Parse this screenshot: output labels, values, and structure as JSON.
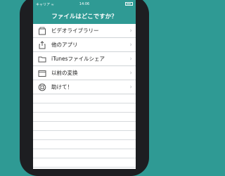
{
  "status": {
    "carrier": "キャリア ≈",
    "time": "14:06"
  },
  "nav": {
    "title": "ファイルはどこですか？"
  },
  "items": [
    {
      "label": "ビデオライブラリー",
      "icon": "video-library-icon"
    },
    {
      "label": "他のアプリ",
      "icon": "share-icon"
    },
    {
      "label": "iTunesファイルシェア",
      "icon": "folder-icon"
    },
    {
      "label": "以前の変換",
      "icon": "previous-conversions-icon"
    },
    {
      "label": "助けて！",
      "icon": "lifebuoy-icon"
    }
  ],
  "colors": {
    "accent": "#2f9a94",
    "chevron": "#b8bcc0"
  }
}
